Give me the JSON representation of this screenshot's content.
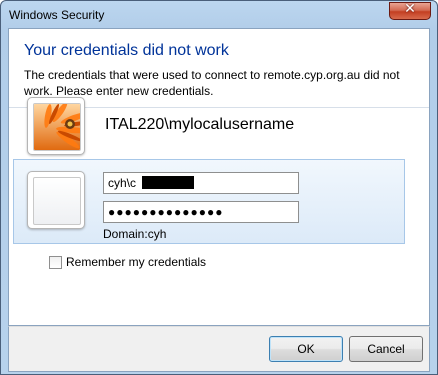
{
  "window": {
    "title": "Windows Security",
    "close_glyph": "✕"
  },
  "header": {
    "headline": "Your credentials did not work",
    "message": "The credentials that were used to connect to remote.cyp.org.au did not work. Please enter new credentials."
  },
  "saved_account": {
    "name": "ITAL220\\mylocalusername",
    "avatar_icon": "flower-avatar-icon"
  },
  "new_credentials": {
    "avatar_icon": "blank-user-avatar-icon",
    "username_value": "cyh\\c",
    "password_mask": "●●●●●●●●●●●●●●",
    "domain_label": "Domain:",
    "domain_value": "cyh"
  },
  "remember": {
    "label": "Remember my credentials",
    "checked": false
  },
  "buttons": {
    "ok": "OK",
    "cancel": "Cancel"
  },
  "colors": {
    "headline": "#003399",
    "panel_border": "#a7c7e8",
    "close_button": "#c33f22"
  }
}
